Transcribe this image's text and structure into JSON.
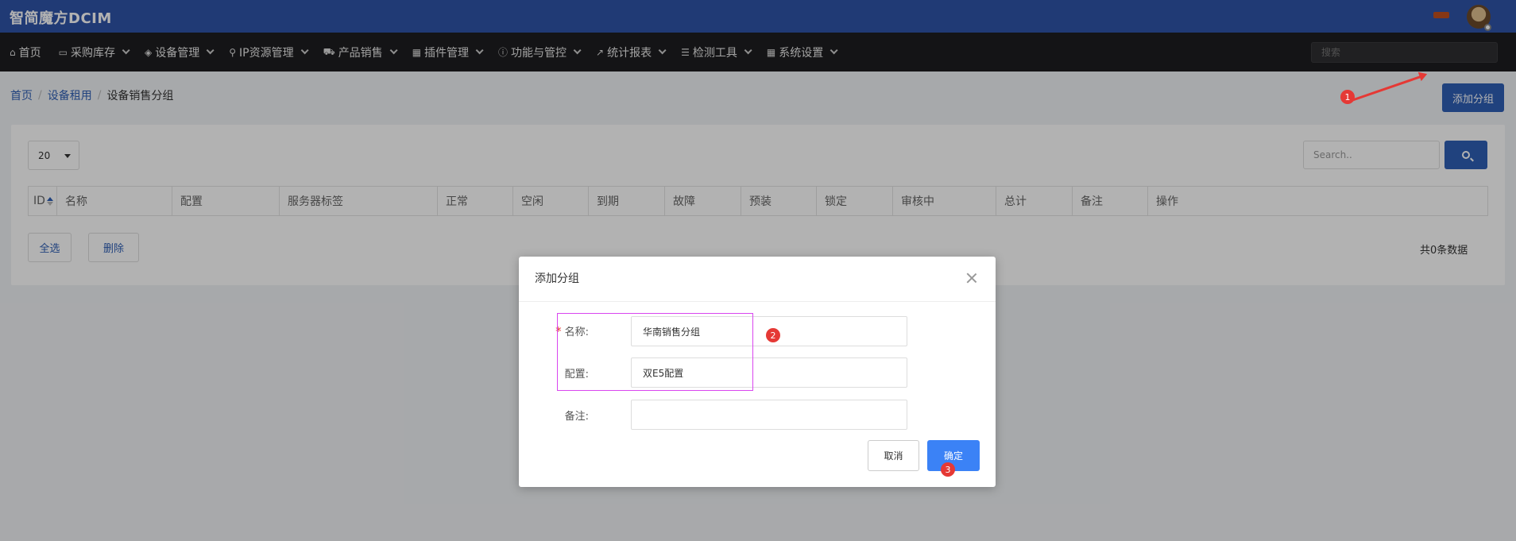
{
  "header": {
    "brand": "智简魔方DCIM",
    "flag_icon": "flag-icon",
    "avatar_icon": "user-avatar"
  },
  "nav": {
    "items": [
      {
        "label": "首页",
        "icon": "home-icon",
        "glyph": "⌂",
        "has_caret": false
      },
      {
        "label": "采购库存",
        "icon": "inbox-icon",
        "glyph": "▭",
        "has_caret": true
      },
      {
        "label": "设备管理",
        "icon": "cube-icon",
        "glyph": "◈",
        "has_caret": true
      },
      {
        "label": "IP资源管理",
        "icon": "map-marker-icon",
        "glyph": "⚲",
        "has_caret": true
      },
      {
        "label": "产品销售",
        "icon": "cart-icon",
        "glyph": "⛟",
        "has_caret": true
      },
      {
        "label": "插件管理",
        "icon": "grid-icon",
        "glyph": "▦",
        "has_caret": true
      },
      {
        "label": "功能与管控",
        "icon": "info-icon",
        "glyph": "ⓘ",
        "has_caret": true
      },
      {
        "label": "统计报表",
        "icon": "chart-icon",
        "glyph": "↗",
        "has_caret": true
      },
      {
        "label": "检测工具",
        "icon": "list-icon",
        "glyph": "☰",
        "has_caret": true
      },
      {
        "label": "系统设置",
        "icon": "grid-small-icon",
        "glyph": "▦",
        "has_caret": true
      }
    ],
    "search_placeholder": "搜索"
  },
  "breadcrumb": {
    "home": "首页",
    "parent": "设备租用",
    "current": "设备销售分组"
  },
  "toolbar": {
    "add_group_label": "添加分组"
  },
  "table": {
    "page_size": "20",
    "search_placeholder": "Search..",
    "columns": [
      "ID",
      "名称",
      "配置",
      "服务器标签",
      "正常",
      "空闲",
      "到期",
      "故障",
      "预装",
      "锁定",
      "审核中",
      "总计",
      "备注",
      "操作"
    ],
    "select_all_label": "全选",
    "delete_label": "删除",
    "total_text": "共0条数据"
  },
  "annotations": {
    "badge1": "1",
    "badge2": "2",
    "badge3": "3"
  },
  "modal": {
    "title": "添加分组",
    "name_label": "名称:",
    "name_value": "华南销售分组",
    "config_label": "配置:",
    "config_value": "双E5配置",
    "remark_label": "备注:",
    "remark_value": "",
    "cancel_label": "取消",
    "confirm_label": "确定"
  },
  "colors": {
    "topbar": "#2f54a8",
    "navbar": "#1e1e20",
    "primary": "#2f5fb5",
    "confirm": "#3b82f6",
    "annotation": "#e53935",
    "highlight": "#d946ef"
  }
}
